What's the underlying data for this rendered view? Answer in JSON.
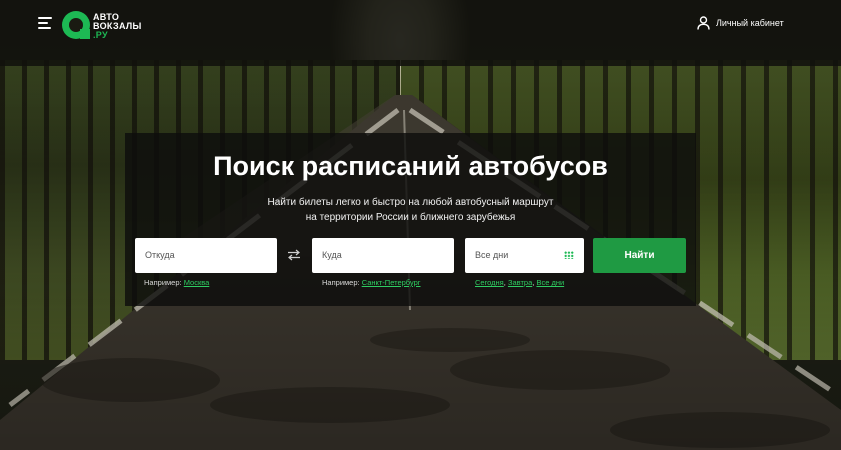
{
  "header": {
    "logo_line1": "АВТО",
    "logo_line2": "ВОКЗАЛЫ",
    "logo_line3": ".РУ",
    "account_label": "Личный кабинет"
  },
  "hero": {
    "title": "Поиск расписаний автобусов",
    "subtitle_line1": "Найти билеты легко и быстро на любой автобусный маршрут",
    "subtitle_line2": "на территории России и ближнего зарубежья"
  },
  "search": {
    "from_placeholder": "Откуда",
    "to_placeholder": "Куда",
    "date_placeholder": "Все дни",
    "find_label": "Найти",
    "from_hint_prefix": "Например:",
    "from_hint_link": "Москва",
    "to_hint_prefix": "Например:",
    "to_hint_link": "Санкт-Петербург",
    "date_links": [
      "Сегодня",
      "Завтра",
      "Все дни"
    ],
    "date_link_separator": ","
  },
  "colors": {
    "accent": "#1db954",
    "button": "#1f9a43",
    "link": "#2ecc61"
  },
  "icons": [
    "menu-icon",
    "user-icon",
    "swap-icon",
    "calendar-icon"
  ]
}
